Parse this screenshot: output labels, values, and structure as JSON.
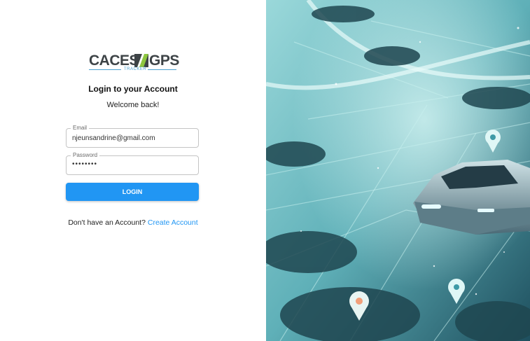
{
  "brand": {
    "name_left": "CACES",
    "name_right": "GPS",
    "tagline": "TRACKER",
    "accent_green": "#8dc63f",
    "accent_blue": "#4aa0cf",
    "mark_icon": "slash-stripes-logo"
  },
  "login": {
    "title": "Login to your Account",
    "subtitle": "Welcome back!",
    "email_label": "Email",
    "email_value": "njeunsandrine@gmail.com",
    "password_label": "Password",
    "password_value": "••••••••",
    "submit_label": "LOGIN",
    "signup_prompt": "Don't have an Account?",
    "signup_link": "Create Account",
    "primary_color": "#2196f3"
  },
  "hero": {
    "image_subject": "car-on-digital-map",
    "icons": [
      "location-pin-icon",
      "location-pin-icon",
      "location-pin-icon"
    ],
    "tint": "#5fb8bf"
  }
}
